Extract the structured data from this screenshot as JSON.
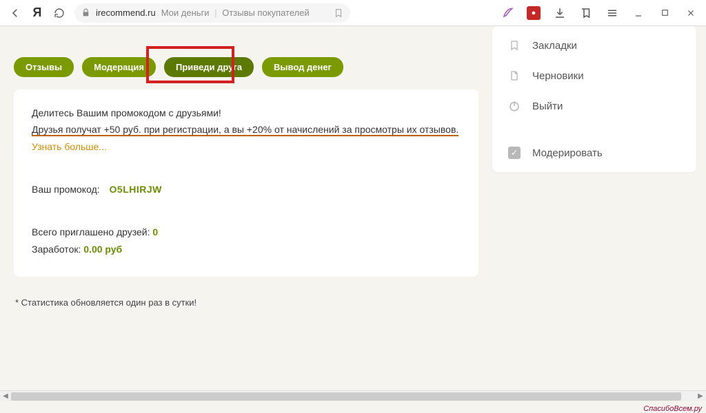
{
  "browser": {
    "domain": "irecommend.ru",
    "title_prefix": "Мои деньги",
    "title_suffix": "Отзывы покупателей",
    "yandex_letter": "Я"
  },
  "tabs": [
    {
      "label": "Отзывы"
    },
    {
      "label": "Модерация"
    },
    {
      "label": "Приведи друга",
      "active": true
    },
    {
      "label": "Вывод денег"
    }
  ],
  "card": {
    "intro": "Делитесь Вашим промокодом с друзьями!",
    "highlight": "Друзья получат +50 руб. при регистрации, а вы +20% от начислений за просмотры их отзывов.",
    "learn_more": "Узнать больше...",
    "promo_label": "Ваш промокод:",
    "promo_code": "O5LHIRJW",
    "invited_label": "Всего приглашено друзей:",
    "invited_value": "0",
    "earned_label": "Заработок:",
    "earned_value": "0.00 руб"
  },
  "footnote": "* Статистика обновляется один раз в сутки!",
  "sidebar": {
    "items": [
      {
        "label": "Закладки",
        "icon": "bookmark"
      },
      {
        "label": "Черновики",
        "icon": "file"
      },
      {
        "label": "Выйти",
        "icon": "power"
      }
    ],
    "moderate": "Модерировать"
  },
  "watermark": "СпасибоВсем.ру"
}
